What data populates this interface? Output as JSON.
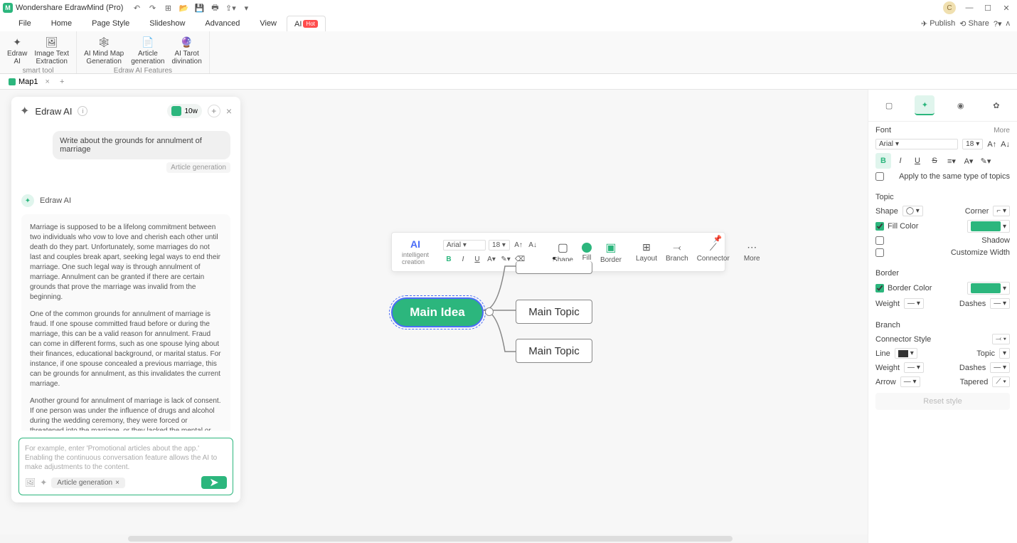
{
  "app": {
    "title": "Wondershare EdrawMind (Pro)",
    "avatar_letter": "C"
  },
  "menubar": {
    "items": [
      "File",
      "Home",
      "Page Style",
      "Slideshow",
      "Advanced",
      "View"
    ],
    "ai_label": "AI",
    "hot_label": "Hot",
    "publish": "Publish",
    "share": "Share"
  },
  "ribbon": {
    "group1": {
      "edraw_ai": "Edraw\nAI",
      "image_text": "Image Text\nExtraction",
      "label": "smart tool"
    },
    "group2": {
      "mindmap": "AI Mind Map\nGeneration",
      "article": "Article\ngeneration",
      "tarot": "AI Tarot\ndivination",
      "label": "Edraw AI Features"
    }
  },
  "tab": {
    "name": "Map1"
  },
  "aipanel": {
    "title": "Edraw AI",
    "credits": "10w",
    "user_msg": "Write about the grounds for annulment of marriage",
    "user_tag": "Article generation",
    "ai_name": "Edraw AI",
    "resp_p1": "Marriage is supposed to be a lifelong commitment between two individuals who vow to love and cherish each other until death do they part. Unfortunately, some marriages do not last and couples break apart, seeking legal ways to end their marriage. One such legal way is through annulment of marriage. Annulment can be granted if there are certain grounds that prove the marriage was invalid from the beginning.",
    "resp_p2": "One of the common grounds for annulment of marriage is fraud. If one spouse committed fraud before or during the marriage, this can be a valid reason for annulment. Fraud can come in different forms, such as one spouse lying about their finances, educational background, or marital status. For instance, if one spouse concealed a previous marriage, this can be grounds for annulment, as this invalidates the current marriage.",
    "resp_p3": "Another ground for annulment of marriage is lack of consent. If one person was under the influence of drugs and alcohol during the wedding ceremony, they were forced or threatened into the marriage, or they lacked the mental or emotional ability to understand the commitment they were making, the marriage can be considered invalid. Lack of consent can also be shown if one party was underage at the time of the",
    "placeholder": "For example, enter 'Promotional articles about the app.' Enabling the continuous conversation feature allows the AI to make adjustments to the content.",
    "chip": "Article generation"
  },
  "floatingbar": {
    "ai_label": "AI",
    "ai_sub": "intelligent\ncreation",
    "font": "Arial",
    "size": "18",
    "shape": "Shape",
    "fill": "Fill",
    "border": "Border",
    "layout": "Layout",
    "branch": "Branch",
    "connector": "Connector",
    "more": "More"
  },
  "mindmap": {
    "main": "Main Idea",
    "topic": "Main Topic"
  },
  "rightpanel": {
    "font_label": "Font",
    "more": "More",
    "font_name": "Arial",
    "font_size": "18",
    "apply_same": "Apply to the same type of topics",
    "topic_label": "Topic",
    "shape": "Shape",
    "corner": "Corner",
    "fill_color": "Fill Color",
    "shadow": "Shadow",
    "custom_width": "Customize Width",
    "border_label": "Border",
    "border_color": "Border Color",
    "weight": "Weight",
    "dashes": "Dashes",
    "branch_label": "Branch",
    "connector_style": "Connector Style",
    "line": "Line",
    "topic": "Topic",
    "arrow": "Arrow",
    "tapered": "Tapered",
    "reset": "Reset style"
  }
}
